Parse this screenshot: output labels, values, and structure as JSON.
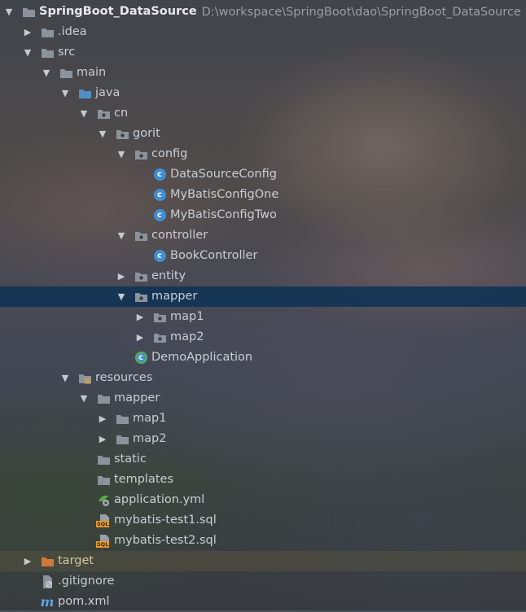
{
  "tree": [
    {
      "label": "SpringBoot_DataSource",
      "path": "D:\\workspace\\SpringBoot\\dao\\SpringBoot_DataSource",
      "depth": 0,
      "arrow": "down",
      "icon": "module-folder",
      "bold": true
    },
    {
      "label": ".idea",
      "depth": 1,
      "arrow": "right",
      "icon": "folder"
    },
    {
      "label": "src",
      "depth": 1,
      "arrow": "down",
      "icon": "folder"
    },
    {
      "label": "main",
      "depth": 2,
      "arrow": "down",
      "icon": "folder"
    },
    {
      "label": "java",
      "depth": 3,
      "arrow": "down",
      "icon": "source-folder"
    },
    {
      "label": "cn",
      "depth": 4,
      "arrow": "down",
      "icon": "package"
    },
    {
      "label": "gorit",
      "depth": 5,
      "arrow": "down",
      "icon": "package"
    },
    {
      "label": "config",
      "depth": 6,
      "arrow": "down",
      "icon": "package"
    },
    {
      "label": "DataSourceConfig",
      "depth": 7,
      "arrow": "none",
      "icon": "class"
    },
    {
      "label": "MyBatisConfigOne",
      "depth": 7,
      "arrow": "none",
      "icon": "class"
    },
    {
      "label": "MyBatisConfigTwo",
      "depth": 7,
      "arrow": "none",
      "icon": "class"
    },
    {
      "label": "controller",
      "depth": 6,
      "arrow": "down",
      "icon": "package"
    },
    {
      "label": "BookController",
      "depth": 7,
      "arrow": "none",
      "icon": "class"
    },
    {
      "label": "entity",
      "depth": 6,
      "arrow": "right",
      "icon": "package"
    },
    {
      "label": "mapper",
      "depth": 6,
      "arrow": "down",
      "icon": "package",
      "selected": true
    },
    {
      "label": "map1",
      "depth": 7,
      "arrow": "right",
      "icon": "package"
    },
    {
      "label": "map2",
      "depth": 7,
      "arrow": "right",
      "icon": "package"
    },
    {
      "label": "DemoApplication",
      "depth": 6,
      "arrow": "none",
      "icon": "spring-boot-class"
    },
    {
      "label": "resources",
      "depth": 3,
      "arrow": "down",
      "icon": "resources-folder"
    },
    {
      "label": "mapper",
      "depth": 4,
      "arrow": "down",
      "icon": "folder"
    },
    {
      "label": "map1",
      "depth": 5,
      "arrow": "right",
      "icon": "folder"
    },
    {
      "label": "map2",
      "depth": 5,
      "arrow": "right",
      "icon": "folder"
    },
    {
      "label": "static",
      "depth": 4,
      "arrow": "none",
      "icon": "folder"
    },
    {
      "label": "templates",
      "depth": 4,
      "arrow": "none",
      "icon": "folder"
    },
    {
      "label": "application.yml",
      "depth": 4,
      "arrow": "none",
      "icon": "yml-file"
    },
    {
      "label": "mybatis-test1.sql",
      "depth": 4,
      "arrow": "none",
      "icon": "sql-file"
    },
    {
      "label": "mybatis-test2.sql",
      "depth": 4,
      "arrow": "none",
      "icon": "sql-file"
    },
    {
      "label": "target",
      "depth": 1,
      "arrow": "right",
      "icon": "excluded-folder",
      "excluded": true
    },
    {
      "label": ".gitignore",
      "depth": 1,
      "arrow": "none",
      "icon": "gitignore-file"
    },
    {
      "label": "pom.xml",
      "depth": 1,
      "arrow": "none",
      "icon": "maven-file"
    }
  ],
  "colors": {
    "selection": "#123455",
    "folder": "#8b939c",
    "class_icon": "#3f8ed1",
    "excluded_folder": "#d0783a",
    "sql_badge": "#e79a2a"
  }
}
